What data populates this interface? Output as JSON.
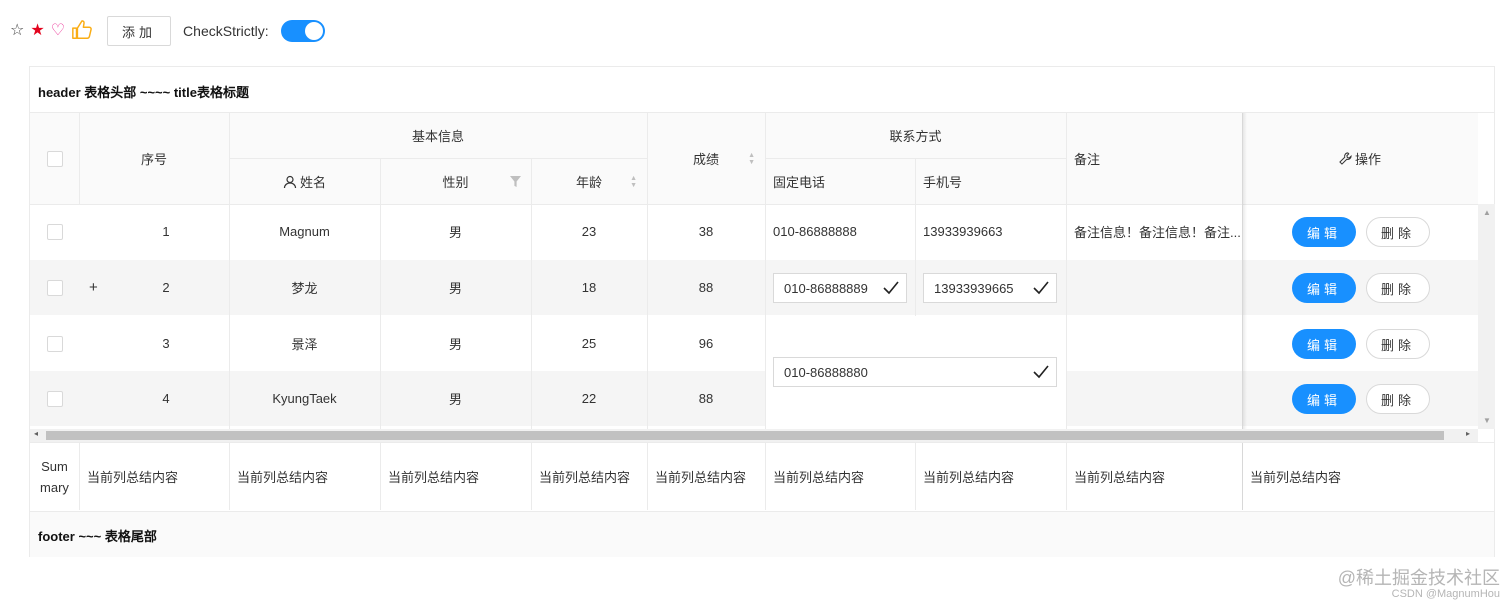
{
  "toolbar": {
    "add_label": "添加",
    "check_strictly_label": "CheckStrictly:",
    "check_strictly_on": true
  },
  "table": {
    "title": "header 表格头部 ~~~~ title表格标题",
    "footer": "footer ~~~ 表格尾部",
    "group_headers": {
      "basic_info": "基本信息",
      "contact": "联系方式"
    },
    "headers": {
      "index": "序号",
      "name": "姓名",
      "gender": "性别",
      "age": "年龄",
      "score": "成绩",
      "phone": "固定电话",
      "mobile": "手机号",
      "remark": "备注",
      "action": "操作"
    },
    "rows": [
      {
        "index": "1",
        "name": "Magnum",
        "gender": "男",
        "age": "23",
        "score": "38",
        "phone": "010-86888888",
        "mobile": "13933939663",
        "remark": "备注信息！备注信息！备注..."
      },
      {
        "index": "2",
        "name": "梦龙",
        "gender": "男",
        "age": "18",
        "score": "88",
        "phone": "010-86888889",
        "mobile": "13933939665",
        "remark": ""
      },
      {
        "index": "3",
        "name": "景泽",
        "gender": "男",
        "age": "25",
        "score": "96",
        "phone": "",
        "mobile": "",
        "remark": ""
      },
      {
        "index": "4",
        "name": "KyungTaek",
        "gender": "男",
        "age": "22",
        "score": "88",
        "phone": "",
        "mobile": "",
        "remark": ""
      }
    ],
    "merged_phone_value": "010-86888880",
    "expand_symbol": "+",
    "edit_label": "编辑",
    "delete_label": "删除",
    "summary_label": "Summary",
    "summary_text": "当前列总结内容"
  },
  "watermark": {
    "line1": "@稀土掘金技术社区",
    "line2": "CSDN @MagnumHou"
  },
  "colors": {
    "primary": "#1890ff",
    "star": "#e3041e",
    "heart": "#eb2f96",
    "like": "#faad14"
  }
}
